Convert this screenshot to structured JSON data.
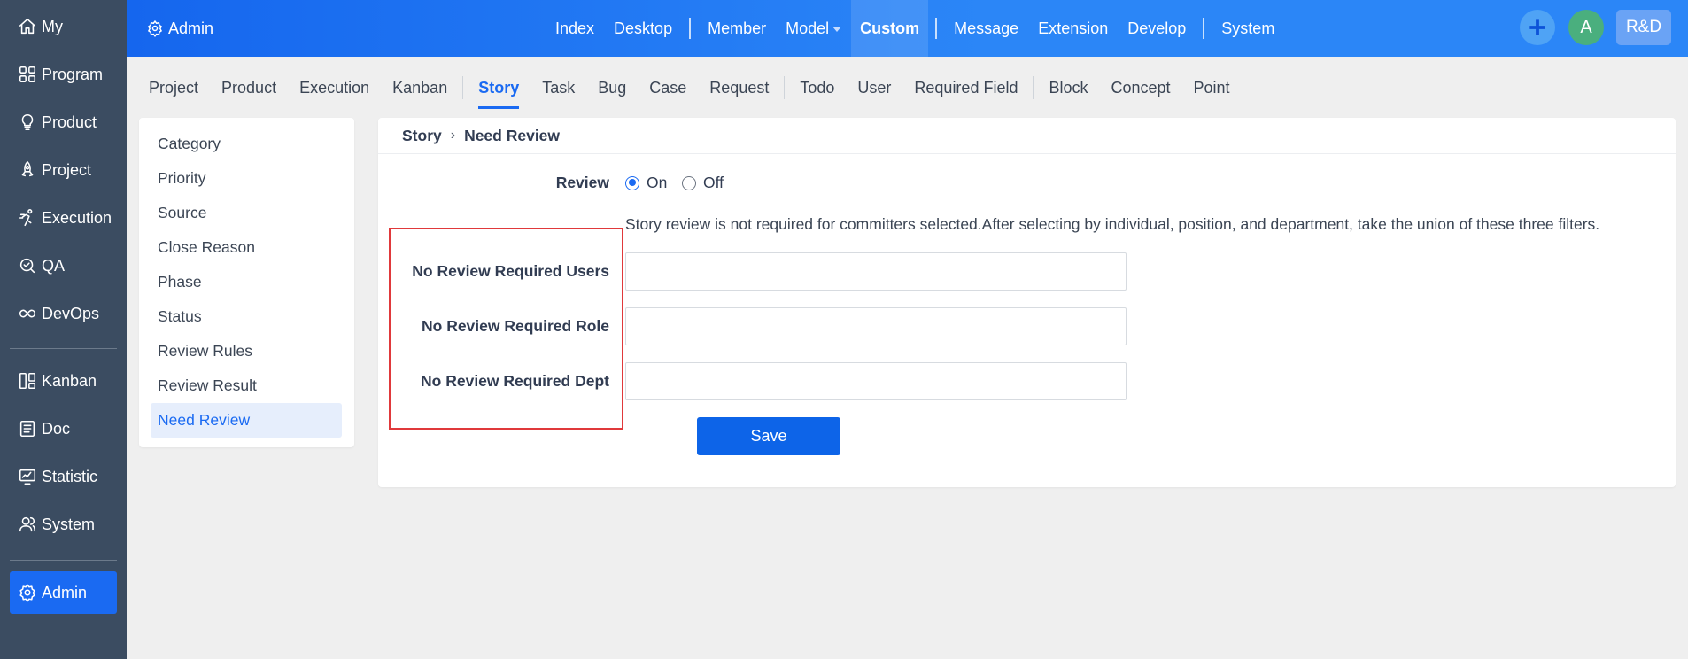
{
  "sidebar": {
    "items": [
      {
        "label": "My",
        "icon": "home-icon"
      },
      {
        "label": "Program",
        "icon": "program-grid-icon"
      },
      {
        "label": "Product",
        "icon": "lightbulb-icon"
      },
      {
        "label": "Project",
        "icon": "rocket-icon"
      },
      {
        "label": "Execution",
        "icon": "runner-icon"
      },
      {
        "label": "QA",
        "icon": "qa-icon"
      },
      {
        "label": "DevOps",
        "icon": "infinity-icon"
      },
      {
        "label": "Kanban",
        "icon": "kanban-icon"
      },
      {
        "label": "Doc",
        "icon": "doc-icon"
      },
      {
        "label": "Statistic",
        "icon": "statistic-icon"
      },
      {
        "label": "System",
        "icon": "users-icon"
      },
      {
        "label": "Admin",
        "icon": "gear-icon",
        "active": true
      }
    ]
  },
  "topbar": {
    "brand": "Admin",
    "nav": [
      "Index",
      "Desktop",
      "Member",
      "Model",
      "Custom",
      "Message",
      "Extension",
      "Develop",
      "System"
    ],
    "active": "Custom",
    "avatar_initial": "A",
    "dept_label": "R&D"
  },
  "subnav": {
    "items": [
      "Project",
      "Product",
      "Execution",
      "Kanban",
      "Story",
      "Task",
      "Bug",
      "Case",
      "Request",
      "Todo",
      "User",
      "Required Field",
      "Block",
      "Concept",
      "Point"
    ],
    "active": "Story"
  },
  "menu": {
    "items": [
      "Category",
      "Priority",
      "Source",
      "Close Reason",
      "Phase",
      "Status",
      "Review Rules",
      "Review Result",
      "Need Review"
    ],
    "active": "Need Review"
  },
  "breadcrumb": {
    "parent": "Story",
    "current": "Need Review"
  },
  "form": {
    "review_label": "Review",
    "review_on": "On",
    "review_off": "Off",
    "review_selected": "On",
    "tip": "Story review is not required for committers selected.After selecting by individual, position, and department, take the union of these three filters.",
    "users_label": "No Review Required Users",
    "role_label": "No Review Required Role",
    "dept_label": "No Review Required Dept",
    "users_value": "",
    "role_value": "",
    "dept_value": "",
    "save_label": "Save"
  },
  "colors": {
    "sidebar_bg": "#3b4c61",
    "accent": "#1a6af2",
    "topbar_start": "#1566ee",
    "highlight": "#e0393b"
  }
}
